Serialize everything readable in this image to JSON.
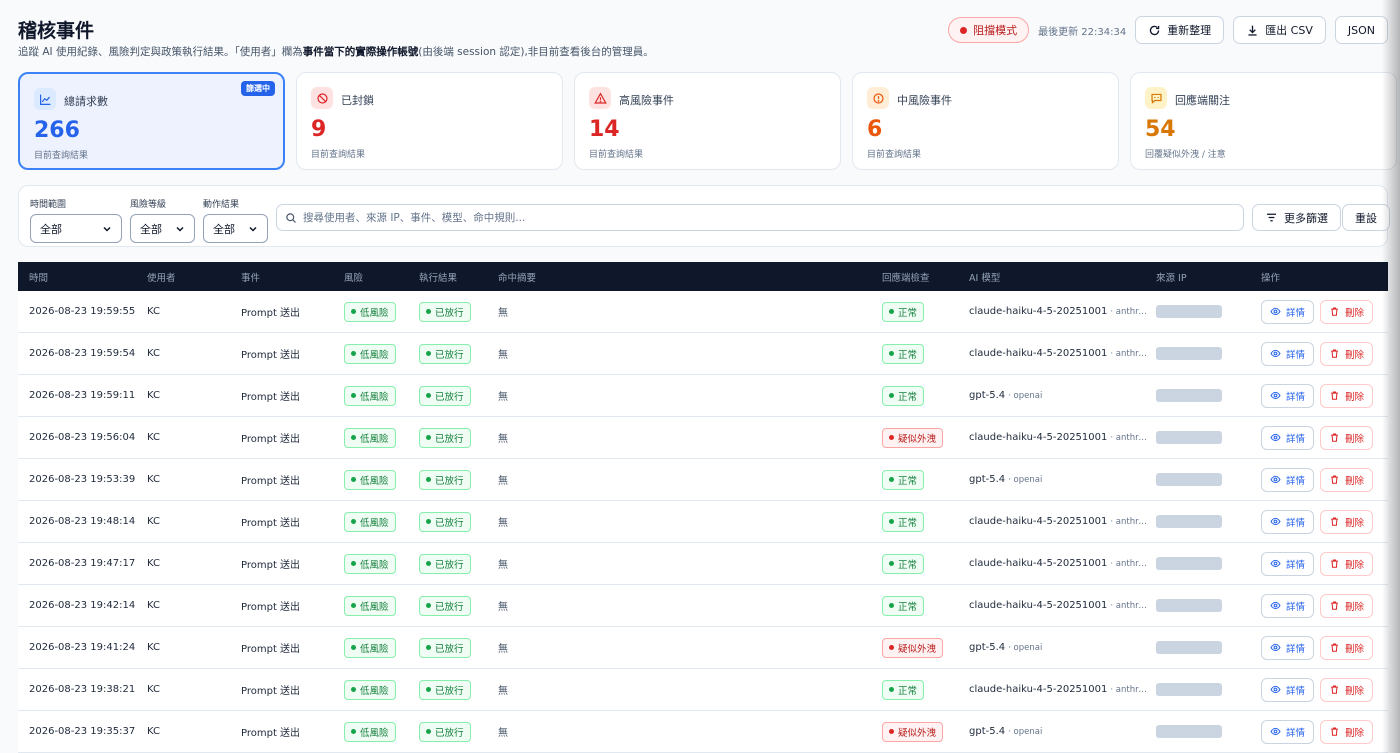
{
  "header": {
    "title": "稽核事件",
    "subtitle_pre": "追蹤 AI 使用紀錄、風險判定與政策執行結果。「使用者」欄為",
    "subtitle_bold": "事件當下的實際操作帳號",
    "subtitle_post": "(由後端 session 認定),非目前查看後台的管理員。",
    "mode_label": "阻擋模式",
    "last_update": "最後更新 22:34:34",
    "refresh_label": "重新整理",
    "csv_label": "匯出 CSV",
    "json_label": "JSON"
  },
  "cards": [
    {
      "label": "總請求數",
      "value": "266",
      "sub": "目前查詢結果",
      "badge": "篩選中",
      "icon": "chart-line-icon",
      "color": "#2563eb"
    },
    {
      "label": "已封鎖",
      "value": "9",
      "sub": "目前查詢結果",
      "icon": "ban-icon",
      "color": "#dc2626"
    },
    {
      "label": "高風險事件",
      "value": "14",
      "sub": "目前查詢結果",
      "icon": "alert-triangle-icon",
      "color": "#dc2626"
    },
    {
      "label": "中風險事件",
      "value": "6",
      "sub": "目前查詢結果",
      "icon": "alert-circle-icon",
      "color": "#ea580c"
    },
    {
      "label": "回應端關注",
      "value": "54",
      "sub": "回覆疑似外洩 / 注意",
      "icon": "message-icon",
      "color": "#d97706"
    }
  ],
  "filters": {
    "time_label": "時間範圍",
    "time_value": "全部",
    "risk_label": "風險等級",
    "risk_value": "全部",
    "action_label": "動作結果",
    "action_value": "全部",
    "search_placeholder": "搜尋使用者、來源 IP、事件、模型、命中規則...",
    "more_label": "更多篩選",
    "reset_label": "重設"
  },
  "table": {
    "columns": [
      "時間",
      "使用者",
      "事件",
      "風險",
      "執行結果",
      "命中摘要",
      "回應端檢查",
      "AI 模型",
      "來源 IP",
      "操作"
    ],
    "view_label": "詳情",
    "delete_label": "刪除",
    "rows": [
      {
        "time": "2026-08-23 19:59:55",
        "user": "KC",
        "event": "Prompt 送出",
        "risk": "低風險",
        "result": "已放行",
        "hit": "無",
        "check": "正常",
        "check_bad": false,
        "model": "claude-haiku-4-5-20251001",
        "provider": "· anthropic"
      },
      {
        "time": "2026-08-23 19:59:54",
        "user": "KC",
        "event": "Prompt 送出",
        "risk": "低風險",
        "result": "已放行",
        "hit": "無",
        "check": "正常",
        "check_bad": false,
        "model": "claude-haiku-4-5-20251001",
        "provider": "· anthropic"
      },
      {
        "time": "2026-08-23 19:59:11",
        "user": "KC",
        "event": "Prompt 送出",
        "risk": "低風險",
        "result": "已放行",
        "hit": "無",
        "check": "正常",
        "check_bad": false,
        "model": "gpt-5.4",
        "provider": "· openai"
      },
      {
        "time": "2026-08-23 19:56:04",
        "user": "KC",
        "event": "Prompt 送出",
        "risk": "低風險",
        "result": "已放行",
        "hit": "無",
        "check": "疑似外洩",
        "check_bad": true,
        "model": "claude-haiku-4-5-20251001",
        "provider": "· anthropic"
      },
      {
        "time": "2026-08-23 19:53:39",
        "user": "KC",
        "event": "Prompt 送出",
        "risk": "低風險",
        "result": "已放行",
        "hit": "無",
        "check": "正常",
        "check_bad": false,
        "model": "gpt-5.4",
        "provider": "· openai"
      },
      {
        "time": "2026-08-23 19:48:14",
        "user": "KC",
        "event": "Prompt 送出",
        "risk": "低風險",
        "result": "已放行",
        "hit": "無",
        "check": "正常",
        "check_bad": false,
        "model": "claude-haiku-4-5-20251001",
        "provider": "· anthropic"
      },
      {
        "time": "2026-08-23 19:47:17",
        "user": "KC",
        "event": "Prompt 送出",
        "risk": "低風險",
        "result": "已放行",
        "hit": "無",
        "check": "正常",
        "check_bad": false,
        "model": "claude-haiku-4-5-20251001",
        "provider": "· anthropic"
      },
      {
        "time": "2026-08-23 19:42:14",
        "user": "KC",
        "event": "Prompt 送出",
        "risk": "低風險",
        "result": "已放行",
        "hit": "無",
        "check": "正常",
        "check_bad": false,
        "model": "claude-haiku-4-5-20251001",
        "provider": "· anthropic"
      },
      {
        "time": "2026-08-23 19:41:24",
        "user": "KC",
        "event": "Prompt 送出",
        "risk": "低風險",
        "result": "已放行",
        "hit": "無",
        "check": "疑似外洩",
        "check_bad": true,
        "model": "gpt-5.4",
        "provider": "· openai"
      },
      {
        "time": "2026-08-23 19:38:21",
        "user": "KC",
        "event": "Prompt 送出",
        "risk": "低風險",
        "result": "已放行",
        "hit": "無",
        "check": "正常",
        "check_bad": false,
        "model": "claude-haiku-4-5-20251001",
        "provider": "· anthropic"
      },
      {
        "time": "2026-08-23 19:35:37",
        "user": "KC",
        "event": "Prompt 送出",
        "risk": "低風險",
        "result": "已放行",
        "hit": "無",
        "check": "疑似外洩",
        "check_bad": true,
        "model": "gpt-5.4",
        "provider": "· openai"
      }
    ]
  }
}
